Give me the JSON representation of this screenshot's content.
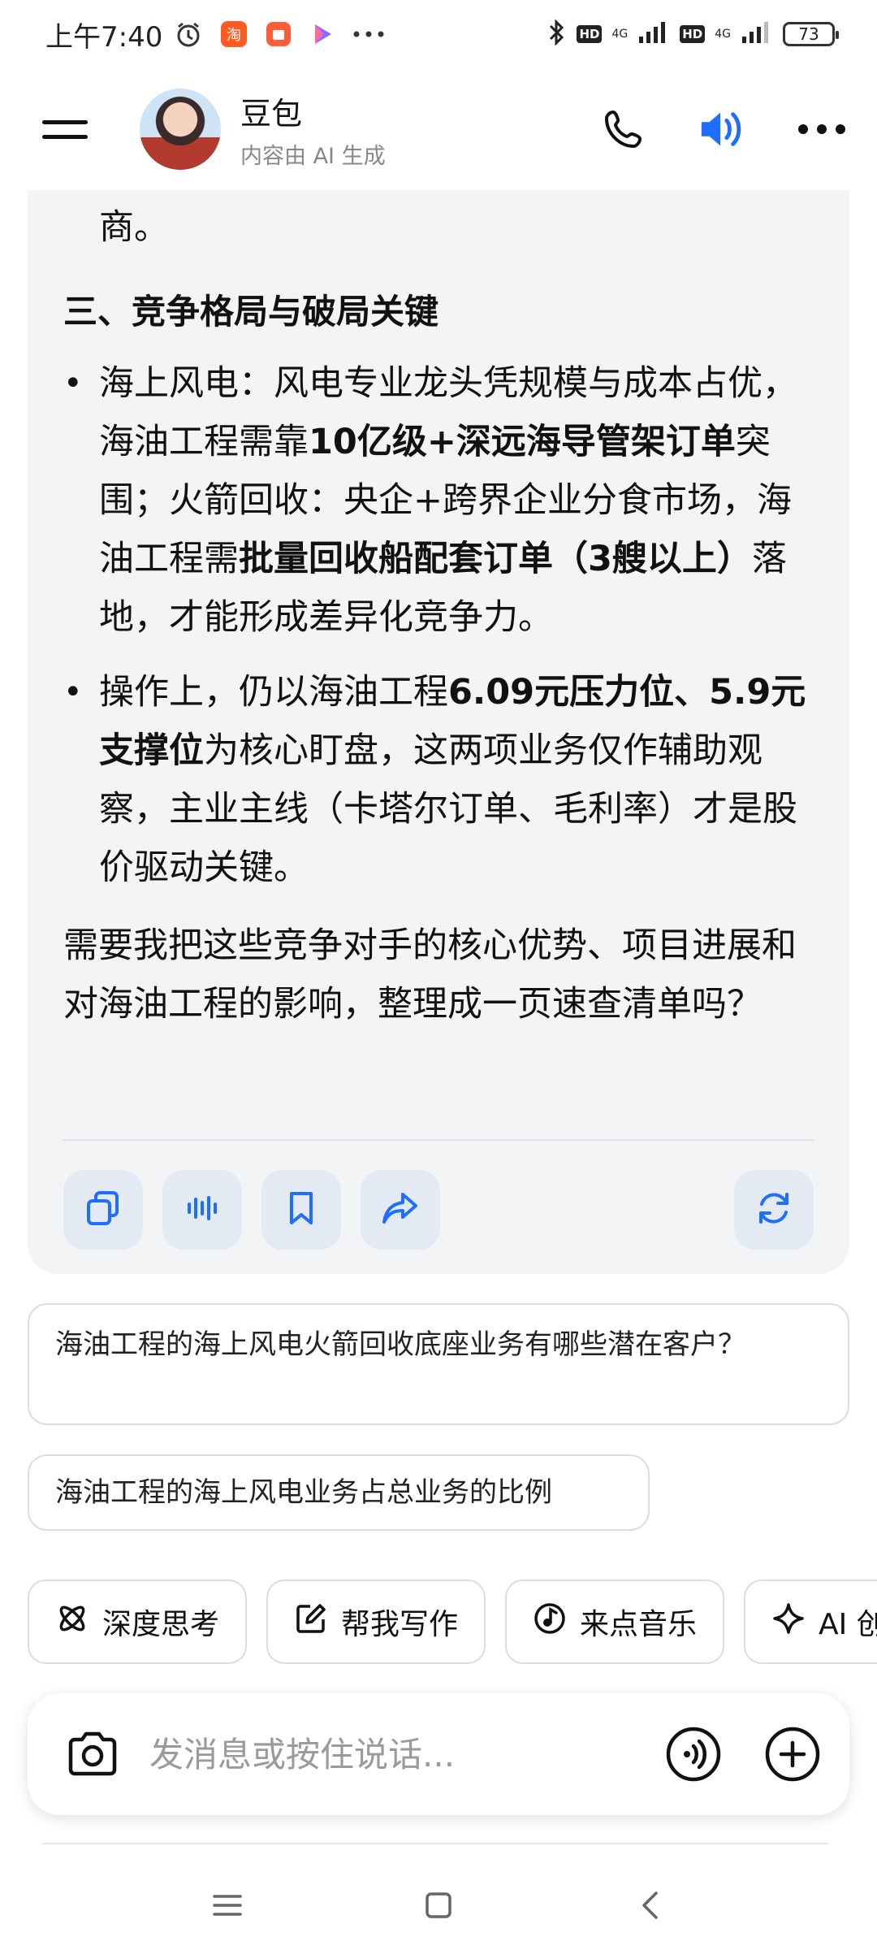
{
  "status_bar": {
    "time": "上午7:40",
    "network_1": "4G",
    "network_2": "4G",
    "hd_1": "HD",
    "hd_2": "HD",
    "battery": "73"
  },
  "header": {
    "name": "豆包",
    "subtitle": "内容由 AI 生成"
  },
  "message": {
    "fragment": "商。",
    "section_title": "三、竞争格局与破局关键",
    "bullet1": {
      "t1": "海上风电：风电专业龙头凭规模与成本占优，海油工程需靠",
      "b1": "10亿级+深远海导管架订单",
      "t2": "突围；火箭回收：央企+跨界企业分食市场，海油工程需",
      "b2": "批量回收船配套订单（3艘以上）",
      "t3": "落地，才能形成差异化竞争力。"
    },
    "bullet2": {
      "t1": "操作上，仍以海油工程",
      "b1": "6.09元压力位、5.9元支撑位",
      "t2": "为核心盯盘，这两项业务仅作辅助观察，主业主线（卡塔尔订单、毛利率）才是股价驱动关键。"
    },
    "closing": "需要我把这些竞争对手的核心优势、项目进展和对海油工程的影响，整理成一页速查清单吗？"
  },
  "suggestions": [
    "海油工程的海上风电火箭回收底座业务有哪些潜在客户？",
    "海油工程的海上风电业务占总业务的比例"
  ],
  "chips": [
    {
      "label": "深度思考",
      "icon": "atom-icon"
    },
    {
      "label": "帮我写作",
      "icon": "edit-icon"
    },
    {
      "label": "来点音乐",
      "icon": "music-icon"
    },
    {
      "label": "AI 创作",
      "icon": "sparkle-icon"
    }
  ],
  "input": {
    "placeholder": "发消息或按住说话..."
  },
  "colors": {
    "accent": "#1E6FFF",
    "card_bg": "#F3F4F6",
    "action_btn_bg": "#E3EAF4"
  }
}
